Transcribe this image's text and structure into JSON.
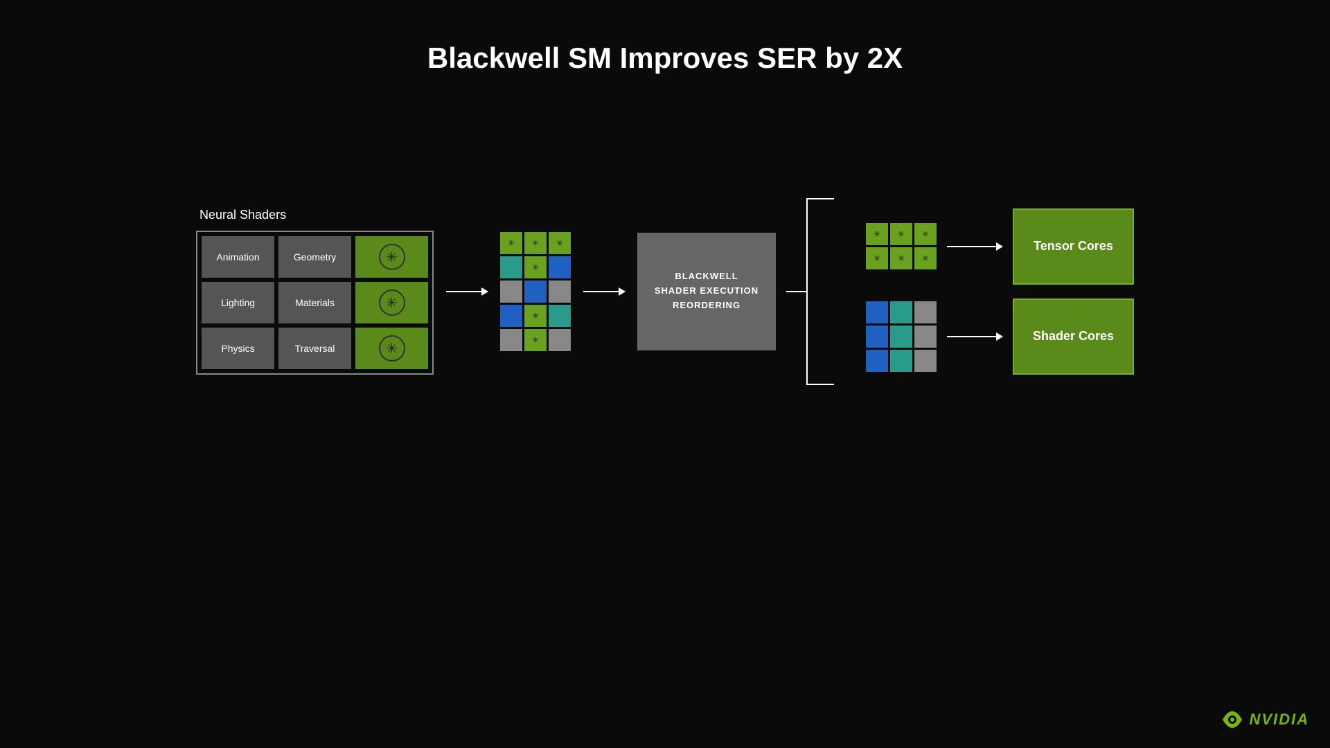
{
  "title": "Blackwell SM Improves SER by 2X",
  "neural_shaders_label": "Neural Shaders",
  "shader_cells": [
    {
      "label": "Animation",
      "type": "gray"
    },
    {
      "label": "Geometry",
      "type": "gray"
    },
    {
      "label": "icon",
      "type": "green"
    },
    {
      "label": "Lighting",
      "type": "gray"
    },
    {
      "label": "Materials",
      "type": "gray"
    },
    {
      "label": "icon",
      "type": "green"
    },
    {
      "label": "Physics",
      "type": "gray"
    },
    {
      "label": "Traversal",
      "type": "gray"
    },
    {
      "label": "icon",
      "type": "green"
    }
  ],
  "ser_box": {
    "line1": "BLACKWELL",
    "line2": "SHADER EXECUTION",
    "line3": "REORDERING"
  },
  "result_boxes": [
    {
      "label": "Tensor Cores"
    },
    {
      "label": "Shader Cores"
    }
  ],
  "nvidia": {
    "text": "NVIDIA"
  },
  "colors": {
    "green": "#6aa220",
    "teal": "#2a9a8a",
    "blue": "#2060c0",
    "gray_light": "#888888",
    "gray_med": "#555555",
    "gray_dark": "#333333"
  }
}
